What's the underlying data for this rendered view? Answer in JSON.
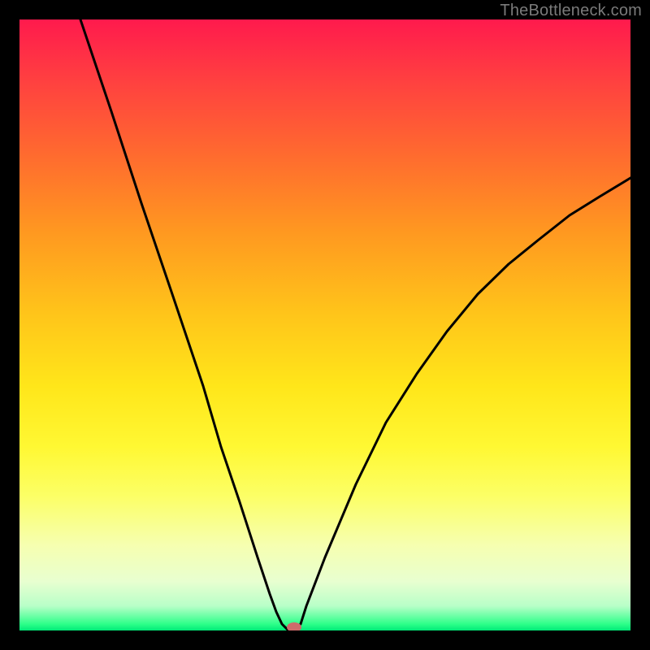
{
  "watermark": "TheBottleneck.com",
  "chart_data": {
    "type": "line",
    "title": "",
    "xlabel": "",
    "ylabel": "",
    "xlim": [
      0,
      100
    ],
    "ylim": [
      0,
      100
    ],
    "x": [
      10,
      15,
      20,
      25,
      30,
      33,
      36,
      39,
      41,
      42,
      43,
      44,
      45,
      46,
      47,
      50,
      55,
      60,
      65,
      70,
      75,
      80,
      85,
      90,
      95,
      100
    ],
    "y": [
      100,
      85,
      70,
      55,
      40,
      30,
      21,
      12,
      6,
      3,
      1,
      0,
      0,
      1,
      4,
      12,
      24,
      34,
      42,
      49,
      55,
      60,
      64,
      68,
      71,
      74
    ],
    "marker": {
      "x": 45,
      "y": 0
    },
    "background_gradient": {
      "top": "#ff1a4d",
      "mid": "#ffe61a",
      "bottom": "#00e878"
    }
  }
}
